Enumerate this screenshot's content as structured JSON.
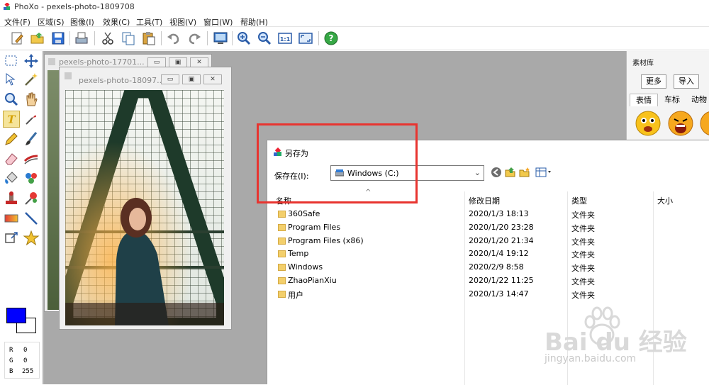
{
  "app": {
    "title": "PhoXo - pexels-photo-1809708"
  },
  "menu": [
    "文件(F)",
    "区域(S)",
    "图像(I)",
    "效果(C)",
    "工具(T)",
    "视图(V)",
    "窗口(W)",
    "帮助(H)"
  ],
  "toolbar_icons": [
    "new-icon",
    "open-icon",
    "save-icon",
    "scan-icon",
    "cut-icon",
    "copy-icon",
    "paste-icon",
    "undo-icon",
    "redo-icon",
    "screen-icon",
    "zoom-in-icon",
    "zoom-out-icon",
    "actual-size-icon",
    "fit-window-icon",
    "help-icon"
  ],
  "tools": [
    "select-rect",
    "move",
    "select-lasso",
    "magic-wand",
    "zoom",
    "hand",
    "text",
    "eyedropper",
    "pencil",
    "brush",
    "eraser",
    "clone",
    "fill",
    "airbrush",
    "stamp",
    "color-replace",
    "gradient",
    "line",
    "transform",
    "shape"
  ],
  "colors": {
    "foreground": "#0000ff",
    "background": "#ffffff",
    "highlight": "#e8342f"
  },
  "rgb": {
    "r_label": "R",
    "r": "0",
    "g_label": "G",
    "g": "0",
    "b_label": "B",
    "b": "255"
  },
  "documents": {
    "back_title": "pexels-photo-17701...",
    "front_title": "pexels-photo-18097..."
  },
  "window_buttons": {
    "minimize": "▭",
    "restore": "▣",
    "close": "✕"
  },
  "material_panel": {
    "title": "素材库",
    "more": "更多",
    "import": "导入",
    "tabs": [
      "表情",
      "车标",
      "动物"
    ]
  },
  "dialog": {
    "title": "另存为",
    "save_in_label": "保存在(I):",
    "location": "Windows (C:)",
    "columns": {
      "name": "名称",
      "date": "修改日期",
      "type": "类型",
      "size": "大小"
    },
    "files": [
      {
        "name": "360Safe",
        "date": "2020/1/3 18:13",
        "type": "文件夹"
      },
      {
        "name": "Program Files",
        "date": "2020/1/20 23:28",
        "type": "文件夹"
      },
      {
        "name": "Program Files (x86)",
        "date": "2020/1/20 21:34",
        "type": "文件夹"
      },
      {
        "name": "Temp",
        "date": "2020/1/4 19:12",
        "type": "文件夹"
      },
      {
        "name": "Windows",
        "date": "2020/2/9 8:58",
        "type": "文件夹"
      },
      {
        "name": "ZhaoPianXiu",
        "date": "2020/1/22 11:25",
        "type": "文件夹"
      },
      {
        "name": "用户",
        "date": "2020/1/3 14:47",
        "type": "文件夹"
      }
    ]
  },
  "watermark": {
    "brand": "Bai du 经验",
    "url": "jingyan.baidu.com"
  }
}
